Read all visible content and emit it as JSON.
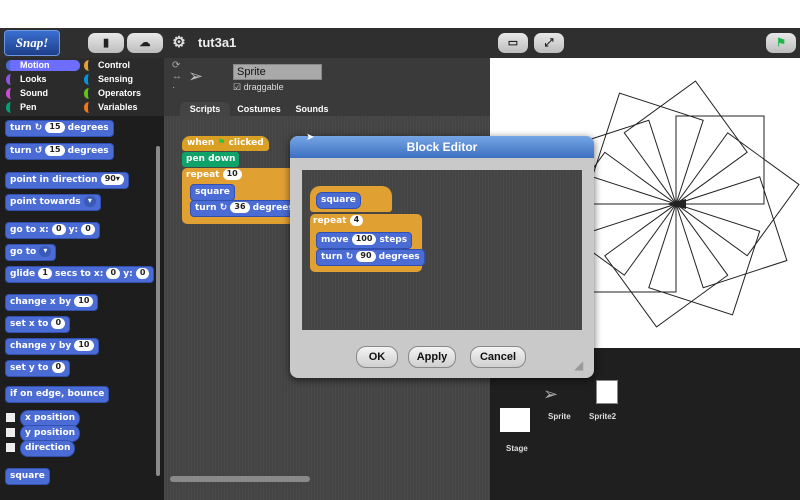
{
  "logo": "Snap!",
  "project_title": "tut3a1",
  "categories": [
    "Motion",
    "Control",
    "Looks",
    "Sensing",
    "Sound",
    "Operators",
    "Pen",
    "Variables"
  ],
  "sprite": {
    "name": "Sprite",
    "draggable_label": "draggable"
  },
  "tabs": [
    "Scripts",
    "Costumes",
    "Sounds"
  ],
  "palette": [
    {
      "text": "turn",
      "icon": "↻",
      "arg": "15",
      "suffix": "degrees"
    },
    {
      "text": "turn",
      "icon": "↺",
      "arg": "15",
      "suffix": "degrees"
    },
    {
      "text": "point in direction",
      "arg": "90▾"
    },
    {
      "text": "point towards",
      "arg": "▾"
    },
    {
      "text": "go to x:",
      "arg": "0",
      "mid": "y:",
      "arg2": "0"
    },
    {
      "text": "go to",
      "arg": "▾"
    },
    {
      "text": "glide",
      "arg": "1",
      "mid": "secs to x:",
      "arg2": "0",
      "mid2": "y:",
      "arg3": "0"
    },
    {
      "text": "change x by",
      "arg": "10"
    },
    {
      "text": "set x to",
      "arg": "0"
    },
    {
      "text": "change y by",
      "arg": "10"
    },
    {
      "text": "set y to",
      "arg": "0"
    },
    {
      "text": "if on edge, bounce"
    }
  ],
  "reporters": [
    "x position",
    "y position",
    "direction"
  ],
  "custom_block": "square",
  "script": {
    "hat": "when",
    "hat_suffix": "clicked",
    "pen": "pen down",
    "repeat": "repeat",
    "repeat_arg": "10",
    "call": "square",
    "turn": "turn",
    "turn_arg": "36",
    "turn_suffix": "degrees"
  },
  "dialog": {
    "title": "Block Editor",
    "hat": "square",
    "repeat": "repeat",
    "repeat_arg": "4",
    "move": "move",
    "move_arg": "100",
    "move_suffix": "steps",
    "turn": "turn",
    "turn_arg": "90",
    "turn_suffix": "degrees",
    "ok": "OK",
    "apply": "Apply",
    "cancel": "Cancel"
  },
  "corral": {
    "sprite": "Sprite",
    "sprite2": "Sprite2",
    "stage": "Stage"
  }
}
